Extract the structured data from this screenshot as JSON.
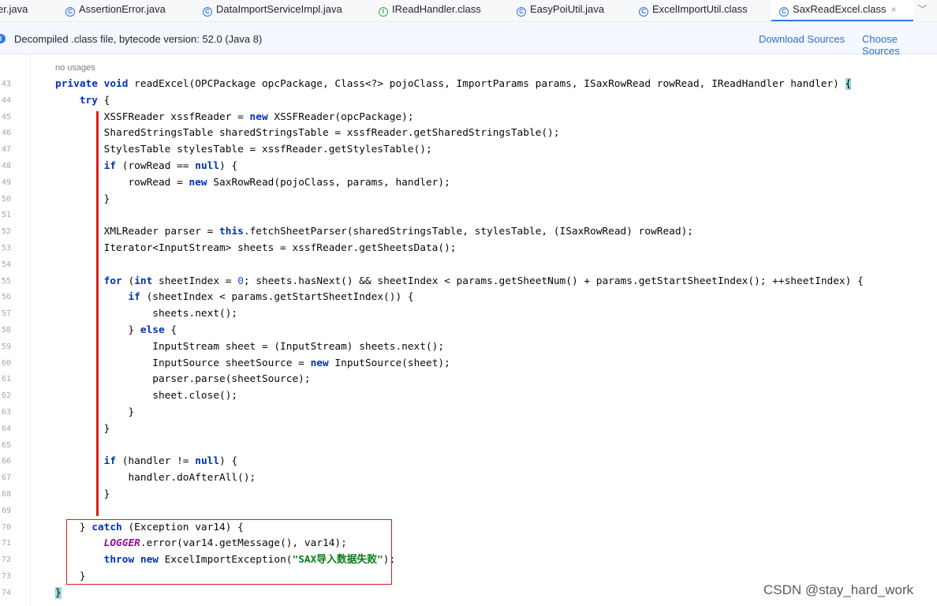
{
  "tabs": [
    {
      "label": "er.java",
      "icon": "none"
    },
    {
      "label": "AssertionError.java",
      "icon": "class-icon"
    },
    {
      "label": "DataImportServiceImpl.java",
      "icon": "class-icon"
    },
    {
      "label": "IReadHandler.class",
      "icon": "interface-icon"
    },
    {
      "label": "EasyPoiUtil.java",
      "icon": "class-icon"
    },
    {
      "label": "ExcelImportUtil.class",
      "icon": "class-icon"
    },
    {
      "label": "SaxReadExcel.class",
      "icon": "class-icon",
      "active": true,
      "close": "×"
    }
  ],
  "tabs_more": "﹀",
  "banner": {
    "message": "Decompiled .class file, bytecode version: 52.0 (Java 8)",
    "download_sources": "Download Sources",
    "choose_sources": "Choose Sources"
  },
  "editor": {
    "usages_hint": "no usages",
    "lines": [
      {
        "n": "43",
        "html": "<b class='kw'>private void</b> readExcel(OPCPackage opcPackage, Class&lt;?&gt; pojoClass, ImportParams params, ISaxRowRead rowRead, IReadHandler handler) <span class='brace'>{</span>"
      },
      {
        "n": "44",
        "html": "    <b class='kw'>try</b> {"
      },
      {
        "n": "45",
        "html": "        XSSFReader xssfReader = <b class='kw'>new</b> XSSFReader(opcPackage);"
      },
      {
        "n": "46",
        "html": "        SharedStringsTable sharedStringsTable = xssfReader.getSharedStringsTable();"
      },
      {
        "n": "47",
        "html": "        StylesTable stylesTable = xssfReader.getStylesTable();"
      },
      {
        "n": "48",
        "html": "        <b class='kw'>if</b> (rowRead == <b class='kw'>null</b>) {"
      },
      {
        "n": "49",
        "html": "            rowRead = <b class='kw'>new</b> SaxRowRead(pojoClass, params, handler);"
      },
      {
        "n": "50",
        "html": "        }"
      },
      {
        "n": "51",
        "html": ""
      },
      {
        "n": "52",
        "html": "        XMLReader parser = <b class='kw'>this</b>.fetchSheetParser(sharedStringsTable, stylesTable, (ISaxRowRead) rowRead);"
      },
      {
        "n": "53",
        "html": "        Iterator&lt;InputStream&gt; sheets = xssfReader.getSheetsData();"
      },
      {
        "n": "54",
        "html": ""
      },
      {
        "n": "55",
        "html": "        <b class='kw'>for</b> (<b class='kw'>int</b> sheetIndex = <span class='num'>0</span>; sheets.hasNext() &amp;&amp; sheetIndex &lt; params.getSheetNum() + params.getStartSheetIndex(); ++sheetIndex) {"
      },
      {
        "n": "56",
        "html": "            <b class='kw'>if</b> (sheetIndex &lt; params.getStartSheetIndex()) {"
      },
      {
        "n": "57",
        "html": "                sheets.next();"
      },
      {
        "n": "58",
        "html": "            } <b class='kw'>else</b> {"
      },
      {
        "n": "59",
        "html": "                InputStream sheet = (InputStream) sheets.next();"
      },
      {
        "n": "60",
        "html": "                InputSource sheetSource = <b class='kw'>new</b> InputSource(sheet);"
      },
      {
        "n": "61",
        "html": "                parser.parse(sheetSource);"
      },
      {
        "n": "62",
        "html": "                sheet.close();"
      },
      {
        "n": "63",
        "html": "            }"
      },
      {
        "n": "64",
        "html": "        }"
      },
      {
        "n": "65",
        "html": ""
      },
      {
        "n": "66",
        "html": "        <b class='kw'>if</b> (handler != <b class='kw'>null</b>) {"
      },
      {
        "n": "67",
        "html": "            handler.doAfterAll();"
      },
      {
        "n": "68",
        "html": "        }"
      },
      {
        "n": "69",
        "html": ""
      },
      {
        "n": "70",
        "html": "    } <b class='kw'>catch</b> (Exception var14) {"
      },
      {
        "n": "71",
        "html": "        <span class='fld'>LOGGER</span>.error(var14.getMessage(), var14);"
      },
      {
        "n": "72",
        "html": "        <b class='kw'>throw new</b> ExcelImportException(<span class='str'>\"SAX导入数据失败\"</span>);"
      },
      {
        "n": "73",
        "html": "    }"
      },
      {
        "n": "74",
        "html": "<span class='brace'>}</span>"
      }
    ]
  },
  "watermark": "CSDN @stay_hard_work",
  "colors": {
    "accent": "#3574f0",
    "annotation_red": "#e01b1b",
    "keyword": "#0033b3",
    "string": "#067d17"
  }
}
